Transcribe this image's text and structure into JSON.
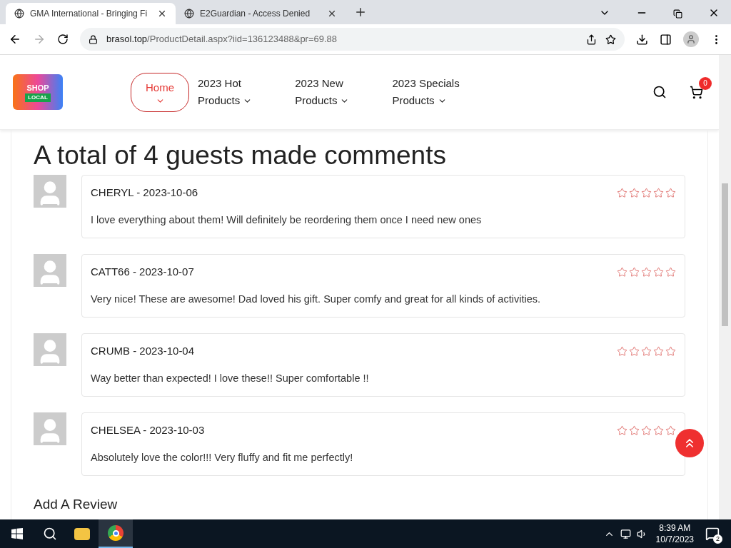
{
  "browser": {
    "tabs": [
      {
        "title": "GMA International - Bringing Fi",
        "selected": true
      },
      {
        "title": "E2Guardian - Access Denied",
        "selected": false
      }
    ],
    "url_host": "brasol.top",
    "url_path": "/ProductDetail.aspx?iid=136123488&pr=69.88"
  },
  "header": {
    "logo": {
      "top": "SHOP",
      "bottom": "LOCAL"
    },
    "nav": [
      {
        "line1": "Home",
        "selected": true
      },
      {
        "line1": "2023 Hot",
        "line2": "Products",
        "selected": false
      },
      {
        "line1": "2023 New",
        "line2": "Products",
        "selected": false
      },
      {
        "line1": "2023 Specials",
        "line2": "Products",
        "selected": false
      }
    ],
    "cart_count": "0"
  },
  "reviews": {
    "title": "A total of 4 guests made comments",
    "items": [
      {
        "byline": "CHERYL - 2023-10-06",
        "stars": 0,
        "text": "I love everything about them! Will definitely be reordering them once I need new ones"
      },
      {
        "byline": "CATT66 - 2023-10-07",
        "stars": 0,
        "text": "Very nice! These are awesome! Dad loved his gift. Super comfy and great for all kinds of activities."
      },
      {
        "byline": "CRUMB - 2023-10-04",
        "stars": 0,
        "text": "Way better than expected! I love these!! Super comfortable !!"
      },
      {
        "byline": "CHELSEA - 2023-10-03",
        "stars": 0,
        "text": "Absolutely love the color!!! Very fluffy and fit me perfectly!"
      }
    ],
    "add_title": "Add A Review"
  },
  "taskbar": {
    "time": "8:39 AM",
    "date": "10/7/2023",
    "notifications": "2"
  }
}
